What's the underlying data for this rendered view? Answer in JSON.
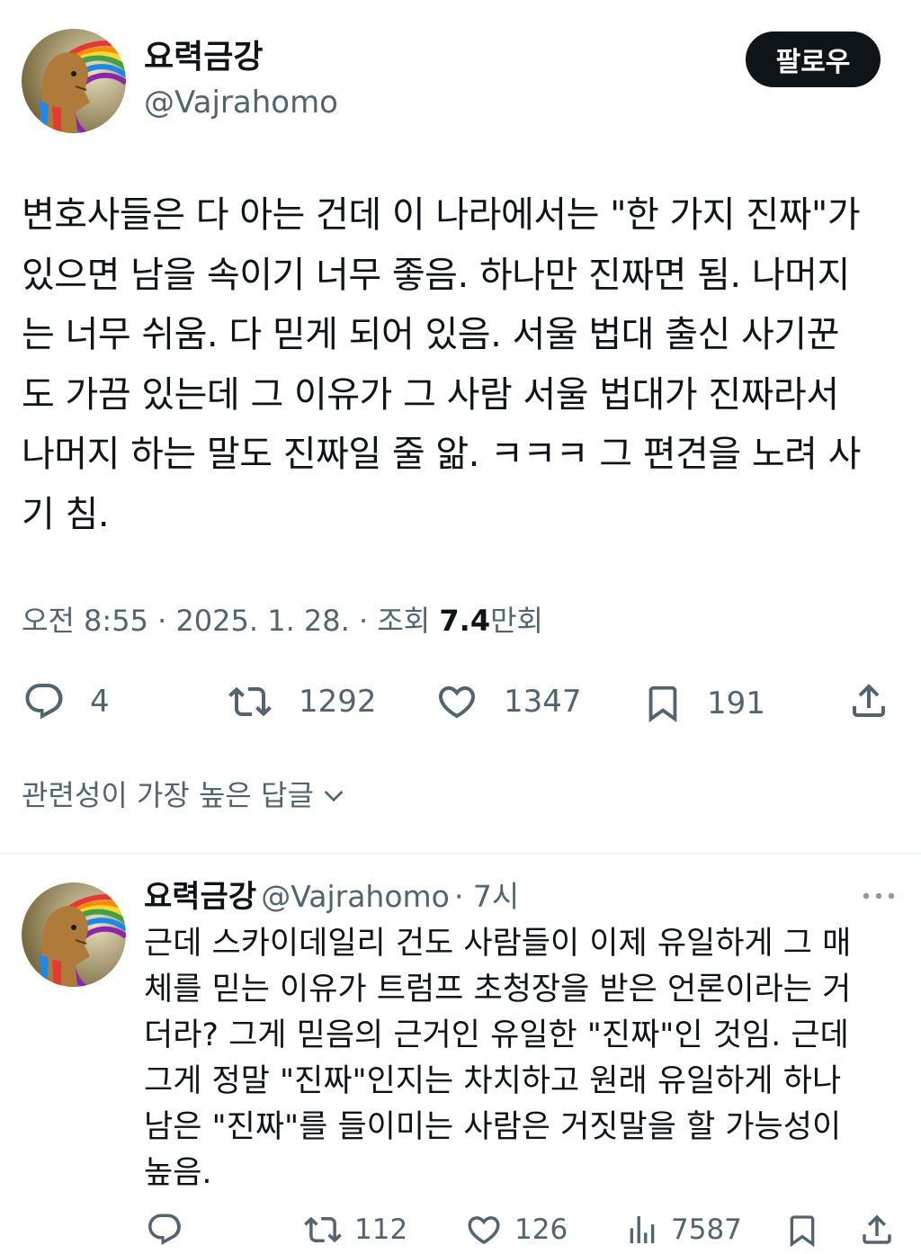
{
  "tweet": {
    "author": {
      "display_name": "요력금강",
      "handle": "@Vajrahomo",
      "avatar": "lion-headed-egyptian-figure-rainbow-avatar"
    },
    "follow_label": "팔로우",
    "text_lines": [
      "변호사들은 다 아는 건데 이 나라에서는 \"한 가지 진짜\"가",
      "있으면 남을 속이기 너무 좋음. 하나만 진짜면 됨. 나머지",
      "는 너무 쉬움. 다 믿게 되어 있음. 서울 법대 출신 사기꾼",
      "도 가끔 있는데 그 이유가 그 사람 서울 법대가 진짜라서",
      "나머지 하는 말도 진짜일 줄 앎. ㅋㅋㅋ 그 편견을 노려 사",
      "기 침."
    ],
    "meta": {
      "time": "오전 8:55",
      "separator": "·",
      "date": "2025. 1. 28.",
      "views_label": "조회",
      "views_value": "7.4",
      "views_unit": "만회"
    },
    "actions": {
      "replies": "4",
      "retweets": "1292",
      "likes": "1347",
      "bookmarks": "191"
    }
  },
  "replies_sort": {
    "label": "관련성이 가장 높은 답글"
  },
  "reply": {
    "author": {
      "display_name": "요력금강",
      "handle": "@Vajrahomo",
      "time": "· 7시"
    },
    "text_lines": [
      "근데 스카이데일리 건도 사람들이 이제 유일하게 그 매",
      "체를 믿는 이유가 트럼프 초청장을 받은 언론이라는 거",
      "더라? 그게 믿음의 근거인 유일한 \"진짜\"인 것임. 근데",
      "그게 정말 \"진짜\"인지는 차치하고 원래 유일하게 하나",
      "남은 \"진짜\"를 들이미는 사람은 거짓말을 할 가능성이",
      "높음."
    ],
    "actions": {
      "retweets": "112",
      "likes": "126",
      "views": "7587"
    }
  },
  "colors": {
    "text_primary": "#0f1419",
    "text_secondary": "#536471",
    "button_bg": "#0f1419",
    "divider": "#eff3f4"
  }
}
